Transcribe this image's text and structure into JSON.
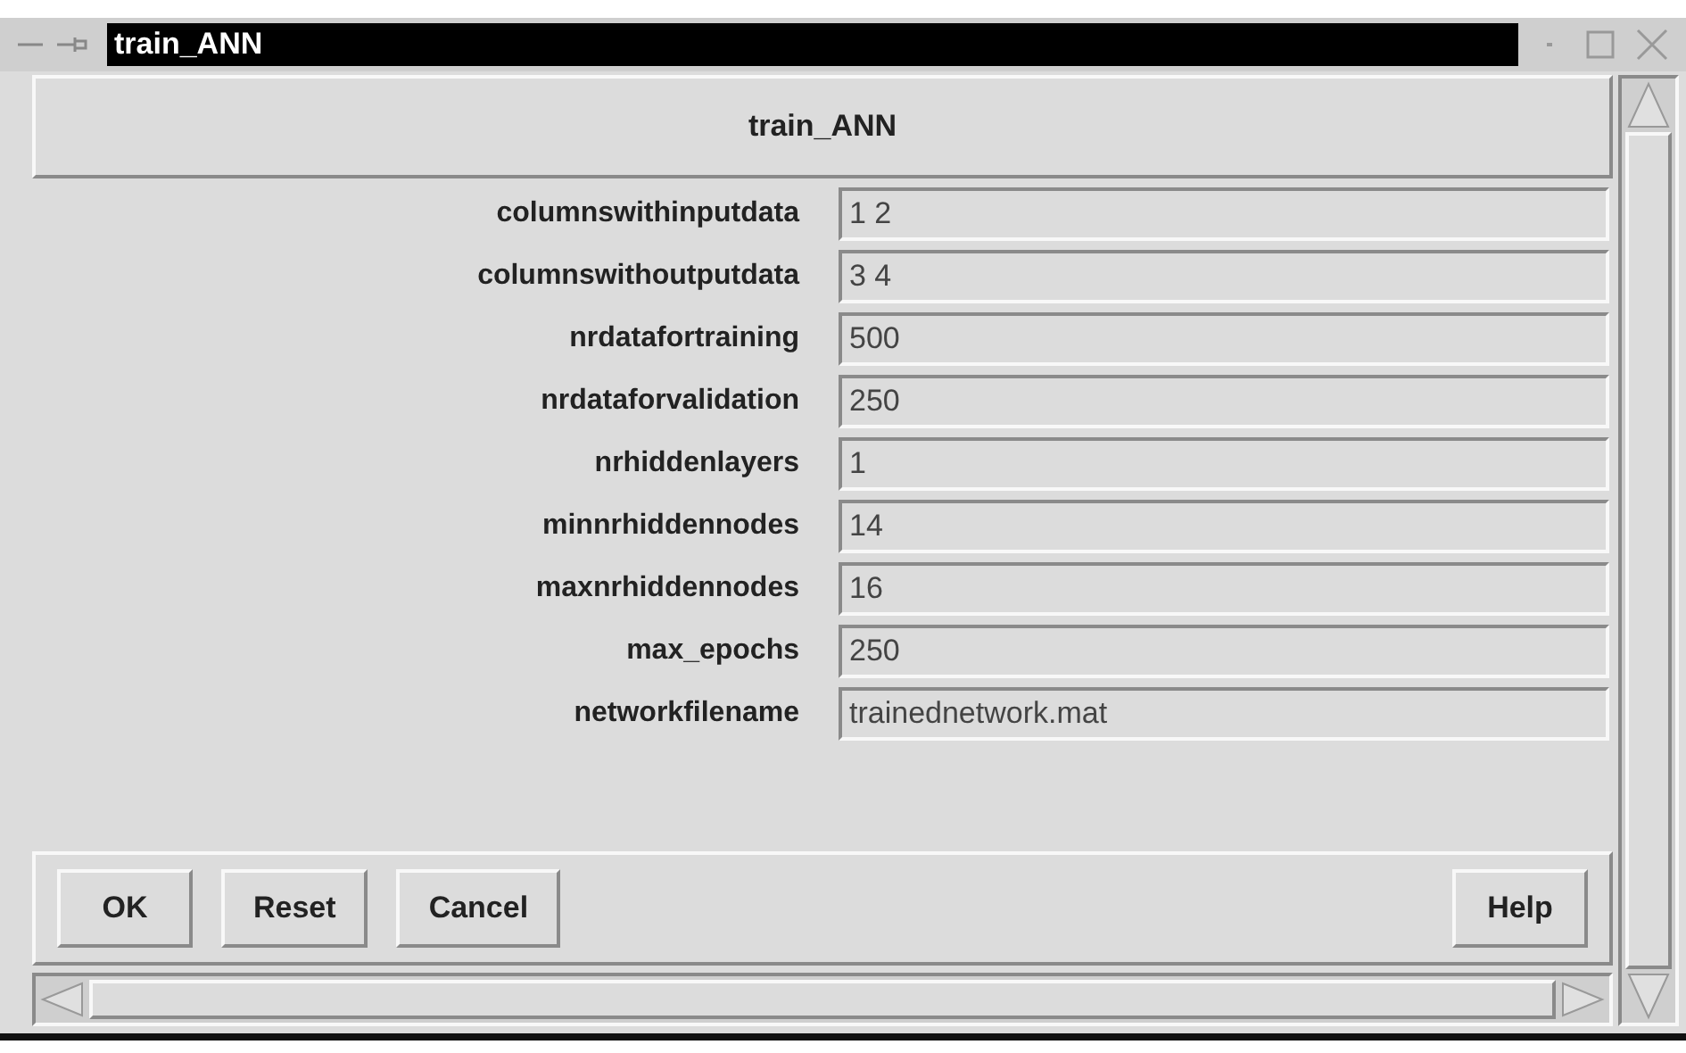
{
  "window": {
    "title": "train_ANN"
  },
  "header": "train_ANN",
  "fields": [
    {
      "label": "columnswithinputdata",
      "value": "1 2"
    },
    {
      "label": "columnswithoutputdata",
      "value": "3 4"
    },
    {
      "label": "nrdatafortraining",
      "value": "500"
    },
    {
      "label": "nrdataforvalidation",
      "value": "250"
    },
    {
      "label": "nrhiddenlayers",
      "value": "1"
    },
    {
      "label": "minnrhiddennodes",
      "value": "14"
    },
    {
      "label": "maxnrhiddennodes",
      "value": "16"
    },
    {
      "label": "max_epochs",
      "value": "250"
    },
    {
      "label": "networkfilename",
      "value": "trainednetwork.mat"
    }
  ],
  "buttons_left": [
    "OK",
    "Reset",
    "Cancel"
  ],
  "buttons_right": [
    "Help"
  ]
}
